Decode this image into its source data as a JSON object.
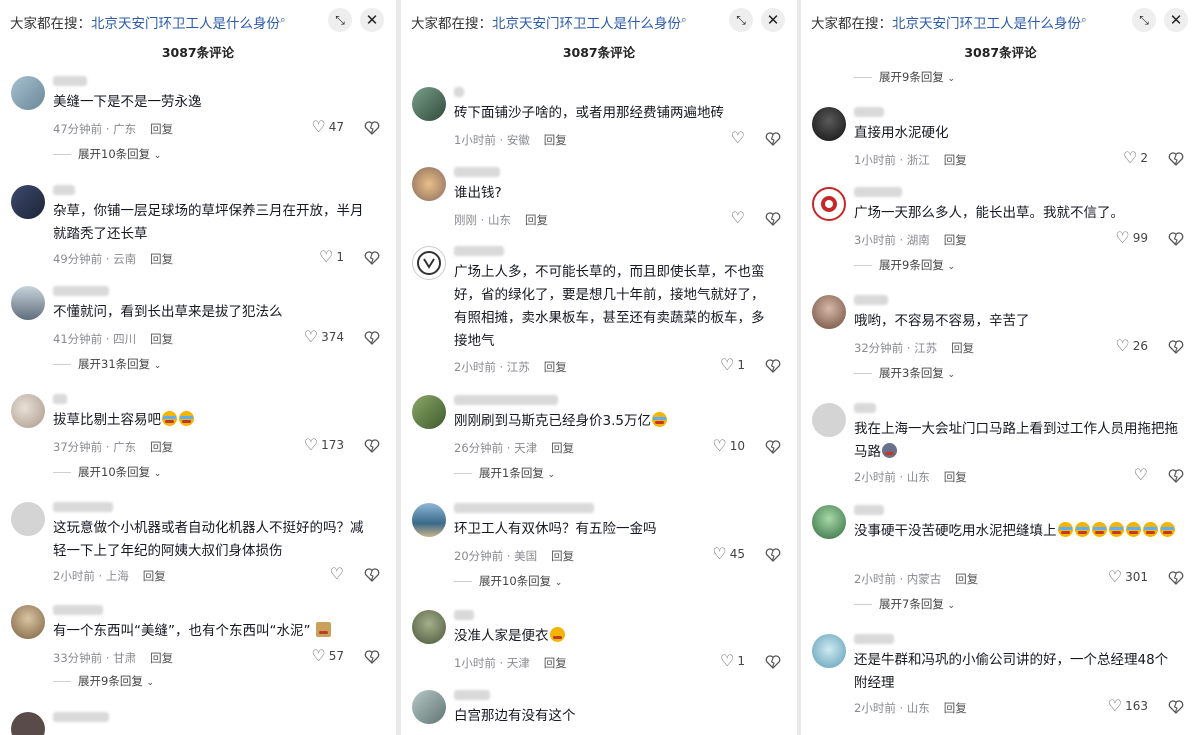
{
  "header": {
    "search_prefix": "大家都在搜：",
    "search_term": "北京天安门环卫工人是什么身份",
    "comment_count": "3087条评论"
  },
  "panels": [
    {
      "comments": [
        {
          "text": "美缝一下是不是一劳永逸",
          "time": "47分钟前 · 广东",
          "reply": "回复",
          "likes": "47",
          "expand": "展开10条回复",
          "avatar_color": "#8aa7b8"
        },
        {
          "text": "杂草，你铺一层足球场的草坪保养三月在开放，半月就踏秃了还长草",
          "time": "49分钟前 · 云南",
          "reply": "回复",
          "likes": "1",
          "avatar_color": "#2f3b54"
        },
        {
          "text": "不懂就问，看到长出草来是拔了犯法么",
          "time": "41分钟前 · 四川",
          "reply": "回复",
          "likes": "374",
          "expand": "展开31条回复",
          "avatar_color": "#7a8a99"
        },
        {
          "text": "拔草比剔土容易吧",
          "time": "37分钟前 · 广东",
          "reply": "回复",
          "likes": "173",
          "expand": "展开10条回复",
          "avatar_color": "#c4b4a6"
        },
        {
          "text": "这玩意做个小机器或者自动化机器人不挺好的吗？减轻一下上了年纪的阿姨大叔们身体损伤",
          "time": "2小时前 · 上海",
          "reply": "回复",
          "likes": "",
          "avatar_color": "#cfcfcf"
        },
        {
          "text": "有一个东西叫“美缝”，也有个东西叫“水泥”",
          "time": "33分钟前 · 甘肃",
          "reply": "回复",
          "likes": "57",
          "expand": "展开9条回复",
          "avatar_color": "#a58c6a"
        }
      ]
    },
    {
      "comments": [
        {
          "text": "砖下面铺沙子啥的，或者用那经费铺两遍地砖",
          "time": "1小时前 · 安徽",
          "reply": "回复",
          "likes": "",
          "avatar_color": "#5d7f6a"
        },
        {
          "text": "谁出钱?",
          "time": "刚刚 · 山东",
          "reply": "回复",
          "likes": "",
          "avatar_color": "#c99a6b"
        },
        {
          "text": "广场上人多，不可能长草的，而且即使长草，不也蛮好，省的绿化了，要是想几十年前，接地气就好了，有照相摊，卖水果板车，甚至还有卖蔬菜的板车，多接地气",
          "time": "2小时前 · 江苏",
          "reply": "回复",
          "likes": "1",
          "avatar_color": "#3a3a3a"
        },
        {
          "text": "刚刚刷到马斯克已经身价3.5万亿",
          "time": "26分钟前 · 天津",
          "reply": "回复",
          "likes": "10",
          "expand": "展开1条回复",
          "avatar_color": "#6b8a4f"
        },
        {
          "text": "环卫工人有双休吗？有五险一金吗",
          "time": "20分钟前 · 美国",
          "reply": "回复",
          "likes": "45",
          "expand": "展开10条回复",
          "avatar_color": "#4f7fa8"
        },
        {
          "text": "没准人家是便衣",
          "time": "1小时前 · 天津",
          "reply": "回复",
          "likes": "1",
          "avatar_color": "#6d7a5b"
        },
        {
          "text": "白宫那边有没有这个",
          "time": "",
          "reply": "",
          "likes": "",
          "avatar_color": "#8fa4a6"
        }
      ]
    },
    {
      "top_expand": "展开9条回复",
      "comments": [
        {
          "text": "直接用水泥硬化",
          "time": "1小时前 · 浙江",
          "reply": "回复",
          "likes": "2",
          "avatar_color": "#2b2b2b"
        },
        {
          "text": "广场一天那么多人，能长出草。我就不信了。",
          "time": "3小时前 · 湖南",
          "reply": "回复",
          "likes": "99",
          "expand": "展开9条回复",
          "avatar_color": "#c62828"
        },
        {
          "text": "哦哟，不容易不容易，辛苦了",
          "time": "32分钟前 · 江苏",
          "reply": "回复",
          "likes": "26",
          "expand": "展开3条回复",
          "avatar_color": "#9b7b6b"
        },
        {
          "text": "我在上海一大会址门口马路上看到过工作人员用拖把拖马路",
          "time": "2小时前 · 山东",
          "reply": "回复",
          "likes": "",
          "avatar_color": "#cfcfcf"
        },
        {
          "text": "没事硬干没苦硬吃用水泥把缝填上",
          "time": "2小时前 · 内蒙古",
          "reply": "回复",
          "likes": "301",
          "expand": "展开7条回复",
          "avatar_color": "#2e8b57"
        },
        {
          "text": "还是牛群和冯巩的小偷公司讲的好，一个总经理48个附经理",
          "time": "2小时前 · 山东",
          "reply": "回复",
          "likes": "163",
          "avatar_color": "#7fb5c9"
        }
      ]
    }
  ],
  "icons": {
    "search": "search-icon",
    "expand": "fullscreen-icon",
    "close": "close-icon",
    "like": "heart-icon",
    "dislike": "broken-heart-icon"
  }
}
